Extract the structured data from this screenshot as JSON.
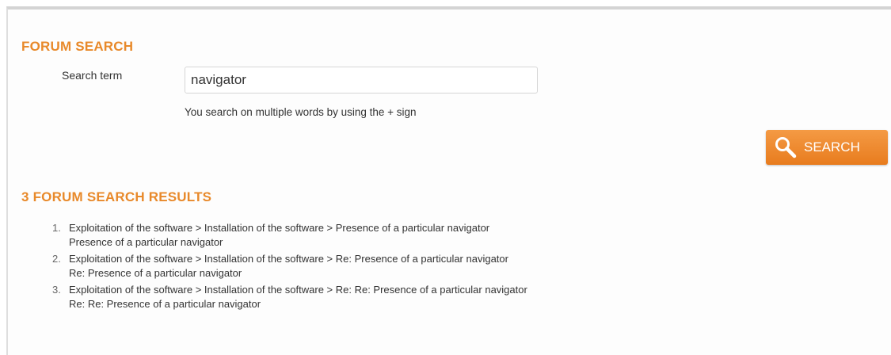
{
  "search_section": {
    "title": "FORUM SEARCH",
    "field_label": "Search term",
    "input_value": "navigator",
    "hint": "You search on multiple words by using the + sign",
    "button_label": "SEARCH",
    "button_icon": "search-icon"
  },
  "results_section": {
    "title": "3 FORUM SEARCH RESULTS",
    "items": [
      {
        "number": "1.",
        "path": "Exploitation of the software > Installation of the software > Presence of a particular navigator",
        "subject": "Presence of a particular navigator"
      },
      {
        "number": "2.",
        "path": "Exploitation of the software > Installation of the software > Re: Presence of a particular navigator",
        "subject": "Re: Presence of a particular navigator"
      },
      {
        "number": "3.",
        "path": "Exploitation of the software > Installation of the software > Re: Re: Presence of a particular navigator",
        "subject": "Re: Re: Presence of a particular navigator"
      }
    ]
  },
  "colors": {
    "accent": "#e8892a",
    "button": "#ef8a32",
    "text": "#333333"
  }
}
